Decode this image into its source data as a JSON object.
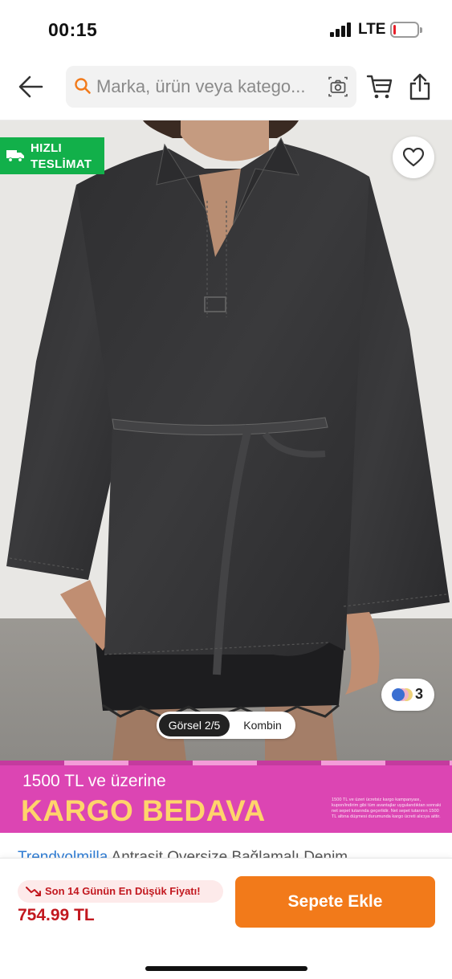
{
  "status_bar": {
    "time": "00:15",
    "network": "LTE",
    "battery_level": 0.1,
    "battery_color": "#e8202a"
  },
  "header": {
    "search": {
      "placeholder": "Marka, ürün veya katego...",
      "icon": "search-icon"
    },
    "icons": [
      "back-arrow-icon",
      "camera-icon",
      "cart-icon",
      "share-icon"
    ]
  },
  "product_image": {
    "fast_delivery": {
      "line1": "HIZLI",
      "line2": "TESLİMAT",
      "color": "#12b04a"
    },
    "favorite_icon": "heart-icon",
    "color_options": {
      "count": "3",
      "dot_colors": [
        "#3b6fd1",
        "#f0b2c8",
        "#efd27a"
      ]
    },
    "gallery_toggle": {
      "image_counter": "Görsel 2/5",
      "combine_label": "Kombin"
    }
  },
  "promo_banner": {
    "line1": "1500 TL ve üzerine",
    "line2": "KARGO BEDAVA",
    "fine_print": "1500 TL ve üzeri ücretsiz kargo kampanyası, kupon/indirim gibi tüm avantajlar uygulandıktan sonraki net sepet tutarında geçerlidir. Net sepet tutarının 1500 TL altına düşmesi durumunda kargo ücreti alıcıya aittir.",
    "background": "#dc45b3",
    "headline_color": "#ffd46b"
  },
  "product": {
    "brand": "Trendyolmilla",
    "name_fragment": "Antrasit Oversize Bağlamalı Denim"
  },
  "bottom_bar": {
    "lowest_price_badge": "Son 14 Günün En Düşük Fiyatı!",
    "price": "754.99 TL",
    "add_to_cart_label": "Sepete Ekle",
    "accent_color": "#f27a1a"
  }
}
